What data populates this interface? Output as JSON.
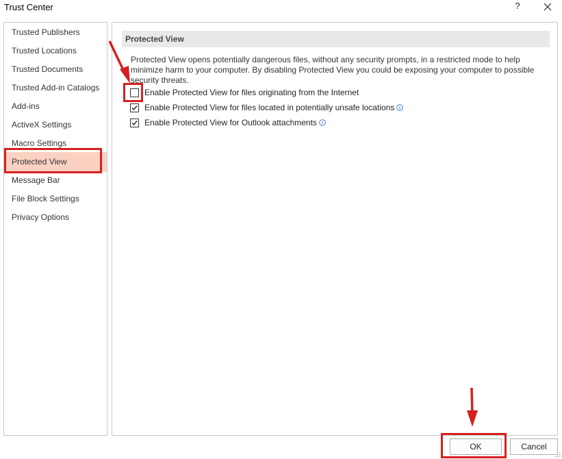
{
  "window": {
    "title": "Trust Center",
    "help_label": "?"
  },
  "sidebar": {
    "items": [
      {
        "label": "Trusted Publishers"
      },
      {
        "label": "Trusted Locations"
      },
      {
        "label": "Trusted Documents"
      },
      {
        "label": "Trusted Add-in Catalogs"
      },
      {
        "label": "Add-ins"
      },
      {
        "label": "ActiveX Settings"
      },
      {
        "label": "Macro Settings"
      },
      {
        "label": "Protected View",
        "selected": true
      },
      {
        "label": "Message Bar"
      },
      {
        "label": "File Block Settings"
      },
      {
        "label": "Privacy Options"
      }
    ]
  },
  "main": {
    "section_title": "Protected View",
    "description": "Protected View opens potentially dangerous files, without any security prompts, in a restricted mode to help minimize harm to your computer. By disabling Protected View you could be exposing your computer to possible security threats.",
    "options": [
      {
        "label": "Enable Protected View for files originating from the Internet",
        "checked": false,
        "info": false
      },
      {
        "label": "Enable Protected View for files located in potentially unsafe locations",
        "checked": true,
        "info": true
      },
      {
        "label": "Enable Protected View for Outlook attachments",
        "checked": true,
        "info": true
      }
    ]
  },
  "buttons": {
    "ok_label": "OK",
    "cancel_label": "Cancel"
  },
  "colors": {
    "annotation_red": "#d61f1f",
    "selected_bg": "#fbd2c2",
    "section_header_bg": "#e9e9e9"
  },
  "icons": {
    "close": "close-icon",
    "check": "checkmark-icon",
    "info": "info-icon",
    "arrow": "red-arrow-icon"
  }
}
